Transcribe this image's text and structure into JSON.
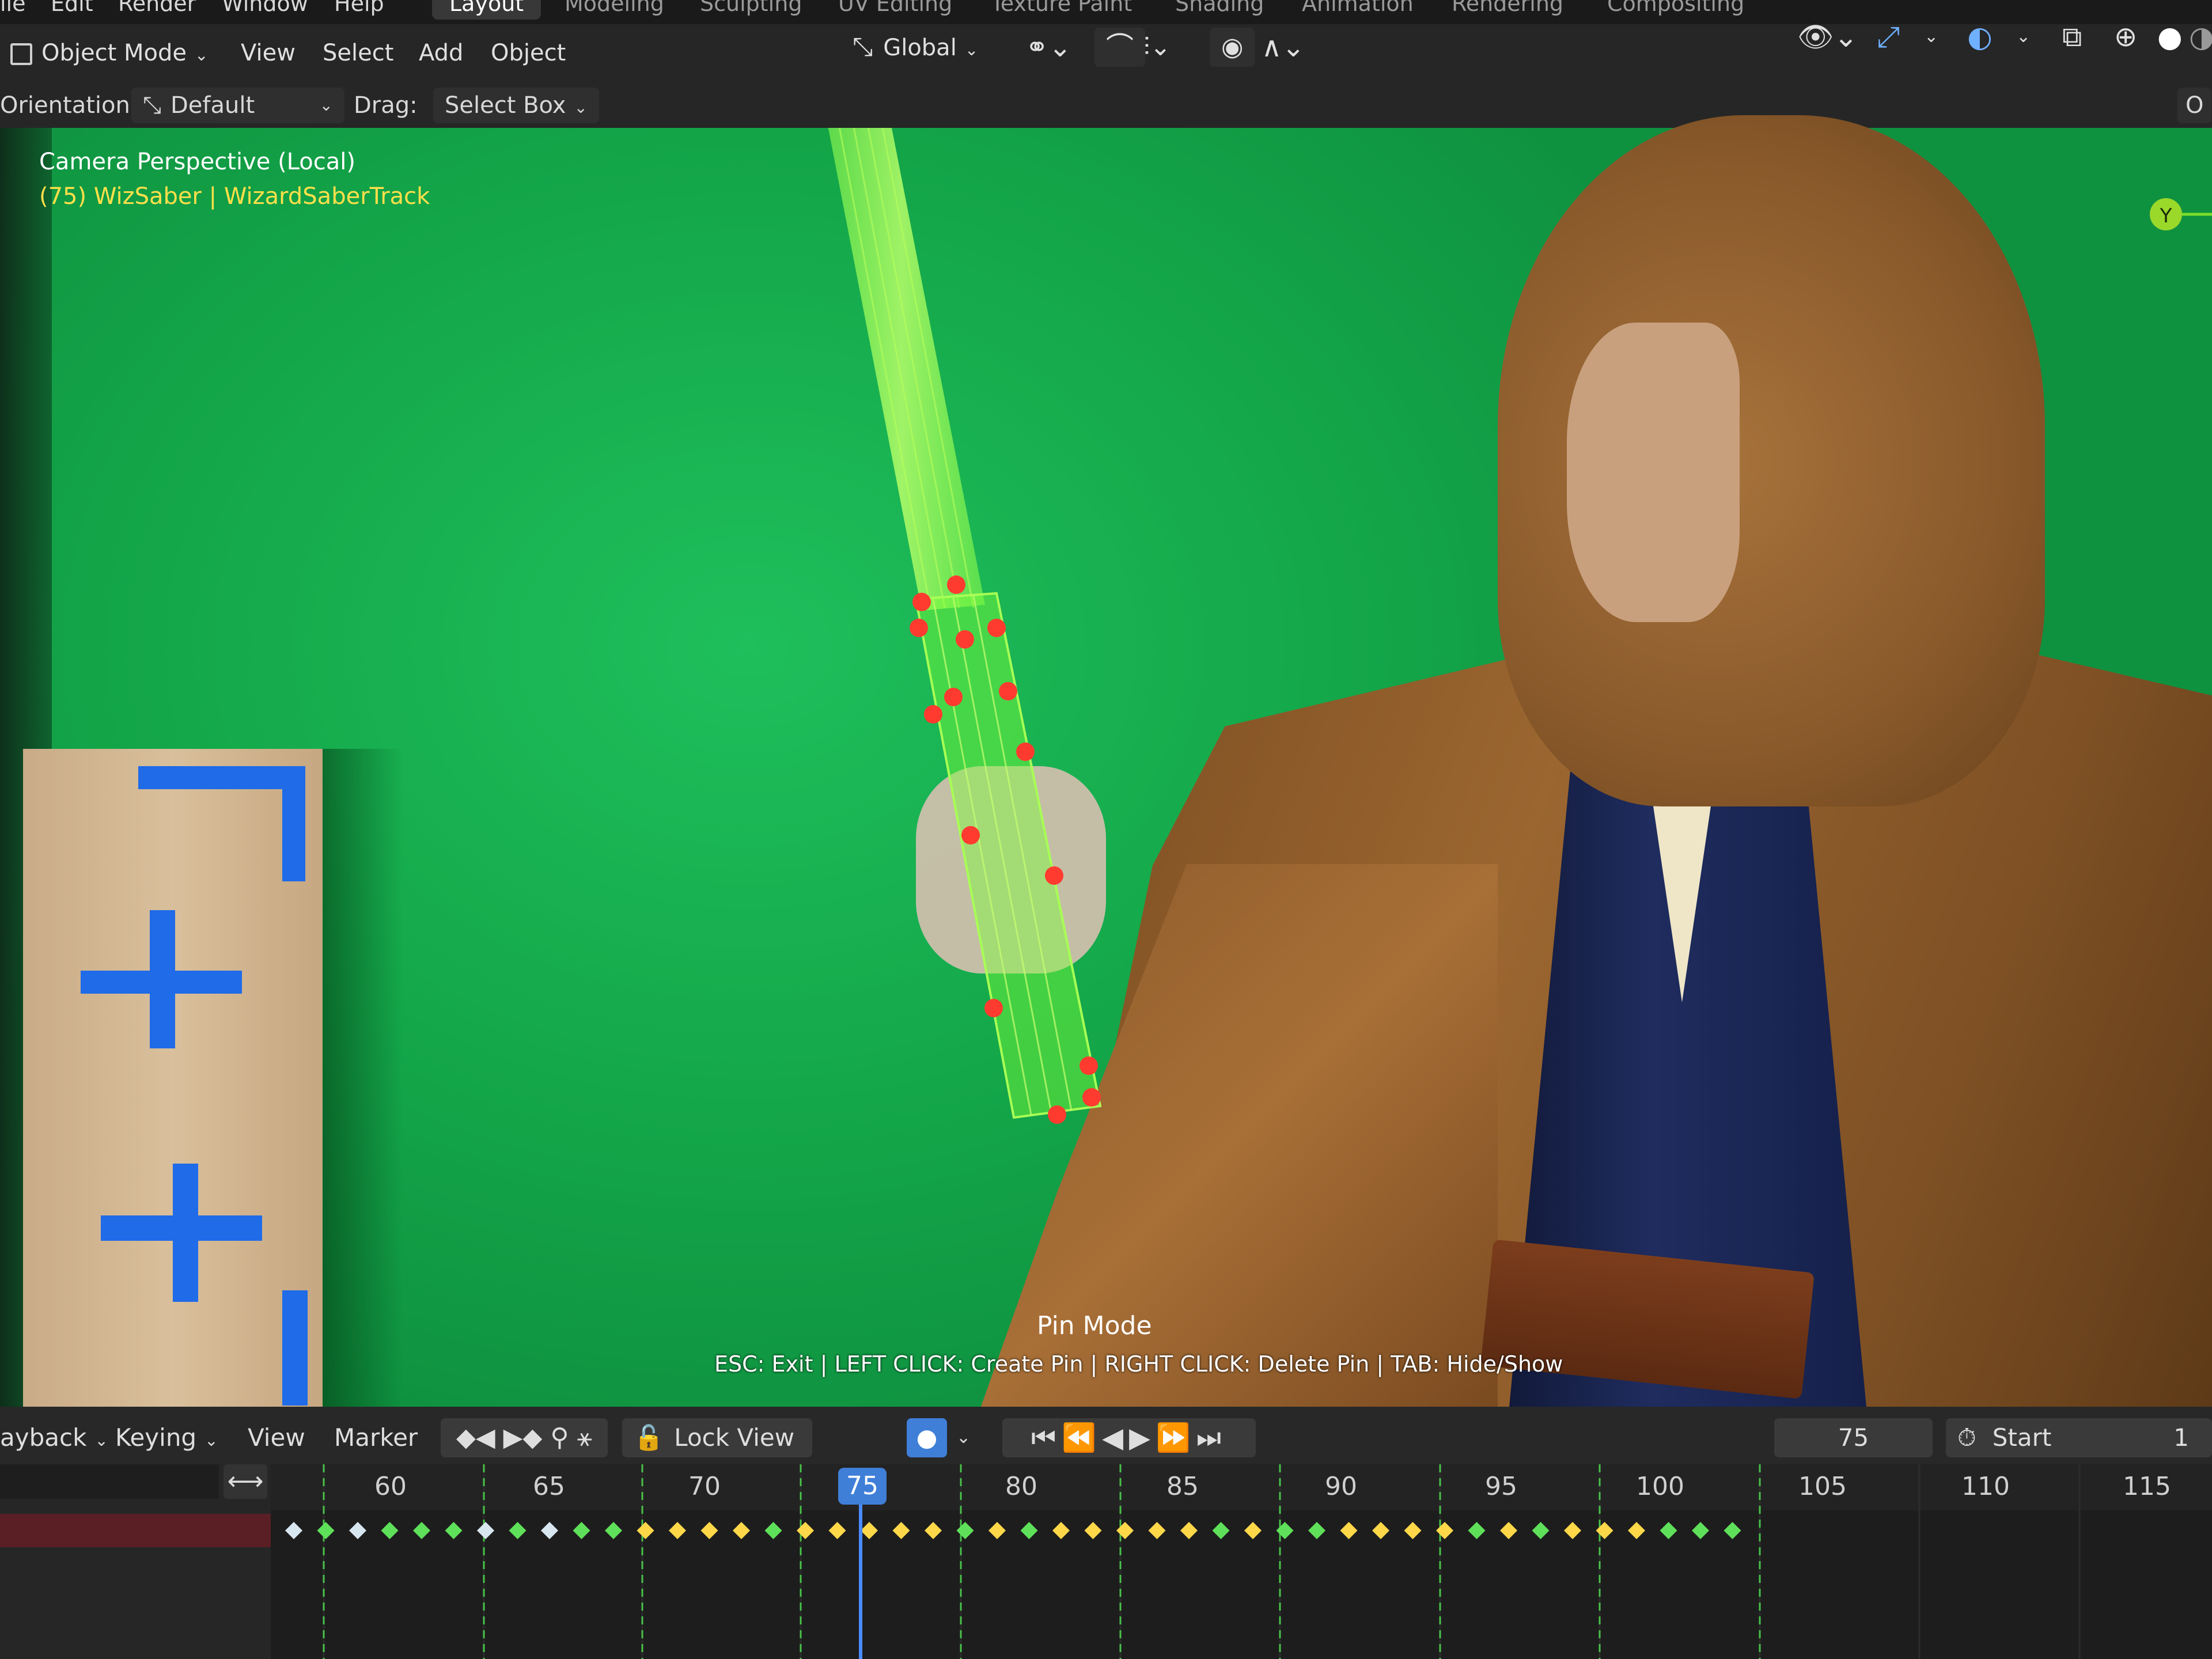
{
  "menu": {
    "items": [
      "ile",
      "Edit",
      "Render",
      "Window",
      "Help"
    ],
    "workspaces": [
      "Layout",
      "Modeling",
      "Sculpting",
      "UV Editing",
      "Texture Paint",
      "Shading",
      "Animation",
      "Rendering",
      "Compositing"
    ],
    "active_workspace": "Layout"
  },
  "header": {
    "mode": "Object Mode",
    "menus": [
      "View",
      "Select",
      "Add",
      "Object"
    ],
    "transform_orientation": "Global"
  },
  "toolbar2": {
    "orientation_label": "Orientation:",
    "orientation_value": "Default",
    "drag_label": "Drag:",
    "drag_value": "Select Box",
    "right_edge": "O"
  },
  "viewport": {
    "view_name": "Camera Perspective (Local)",
    "active_object": "(75) WizSaber | WizardSaberTrack",
    "axis_label": "Y",
    "status_title": "Pin Mode",
    "status_help": "ESC: Exit | LEFT CLICK: Create Pin | RIGHT CLICK: Delete Pin | TAB: Hide/Show"
  },
  "timeline": {
    "menus": [
      "ayback",
      "Keying",
      "View",
      "Marker"
    ],
    "lock_view": "Lock View",
    "current_frame": "75",
    "start_label": "Start",
    "start_value": "1",
    "ticks": [
      "60",
      "65",
      "70",
      "75",
      "80",
      "85",
      "90",
      "95",
      "100",
      "105",
      "110",
      "115"
    ]
  },
  "colors": {
    "accent": "#4a8cff",
    "pin": "#ff3b30",
    "saber": "#6cff2a",
    "key_white": "#d8e6f0",
    "key_green": "#5fe05a",
    "key_yellow": "#ffd84a"
  }
}
